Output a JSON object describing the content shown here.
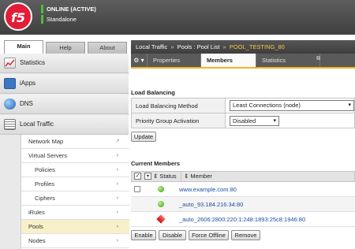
{
  "header": {
    "logo_text": "f5",
    "status": "ONLINE (ACTIVE)",
    "mode": "Standalone"
  },
  "main_tabs": [
    {
      "label": "Main"
    },
    {
      "label": "Help"
    },
    {
      "label": "About"
    }
  ],
  "sidebar": {
    "top_items": [
      {
        "label": "Statistics",
        "icon": "statistics-icon"
      },
      {
        "label": "iApps",
        "icon": "iapps-icon"
      },
      {
        "label": "DNS",
        "icon": "dns-globe-icon"
      },
      {
        "label": "Local Traffic",
        "icon": "local-traffic-icon"
      }
    ],
    "sub_items": [
      {
        "label": "Network Map"
      },
      {
        "label": "Virtual Servers"
      },
      {
        "label": "Policies"
      },
      {
        "label": "Profiles"
      },
      {
        "label": "Ciphers"
      },
      {
        "label": "iRules"
      },
      {
        "label": "Pools"
      },
      {
        "label": "Nodes"
      }
    ]
  },
  "breadcrumb": {
    "part1": "Local Traffic",
    "sep": "»",
    "part2": "Pools : Pool List",
    "current": "POOL_TESTING_80"
  },
  "content_tabs": [
    {
      "label": "Properties"
    },
    {
      "label": "Members"
    },
    {
      "label": "Statistics"
    }
  ],
  "load_balancing": {
    "title": "Load Balancing",
    "method_label": "Load Balancing Method",
    "method_value": "Least Connections (node)",
    "priority_label": "Priority Group Activation",
    "priority_value": "Disabled",
    "update_button": "Update"
  },
  "members": {
    "title": "Current Members",
    "col_status": "Status",
    "col_member": "Member",
    "sort_glyph": "⇕",
    "rows": [
      {
        "member": "www.example.com:80",
        "status": "green",
        "checkbox": true
      },
      {
        "member": "_auto_93.184.216.34:80",
        "status": "green",
        "checkbox": false
      },
      {
        "member": "_auto_2606:2800:220:1:248:1893:25c8:1946:80",
        "status": "red",
        "checkbox": false
      }
    ],
    "buttons": [
      {
        "label": "Enable"
      },
      {
        "label": "Disable"
      },
      {
        "label": "Force Offline"
      },
      {
        "label": "Remove"
      }
    ]
  },
  "colors": {
    "accent_yellow": "#f0b824",
    "status_green": "#4ebd3e",
    "logo_red": "#e21d38",
    "link_blue": "#1a4fa3"
  }
}
